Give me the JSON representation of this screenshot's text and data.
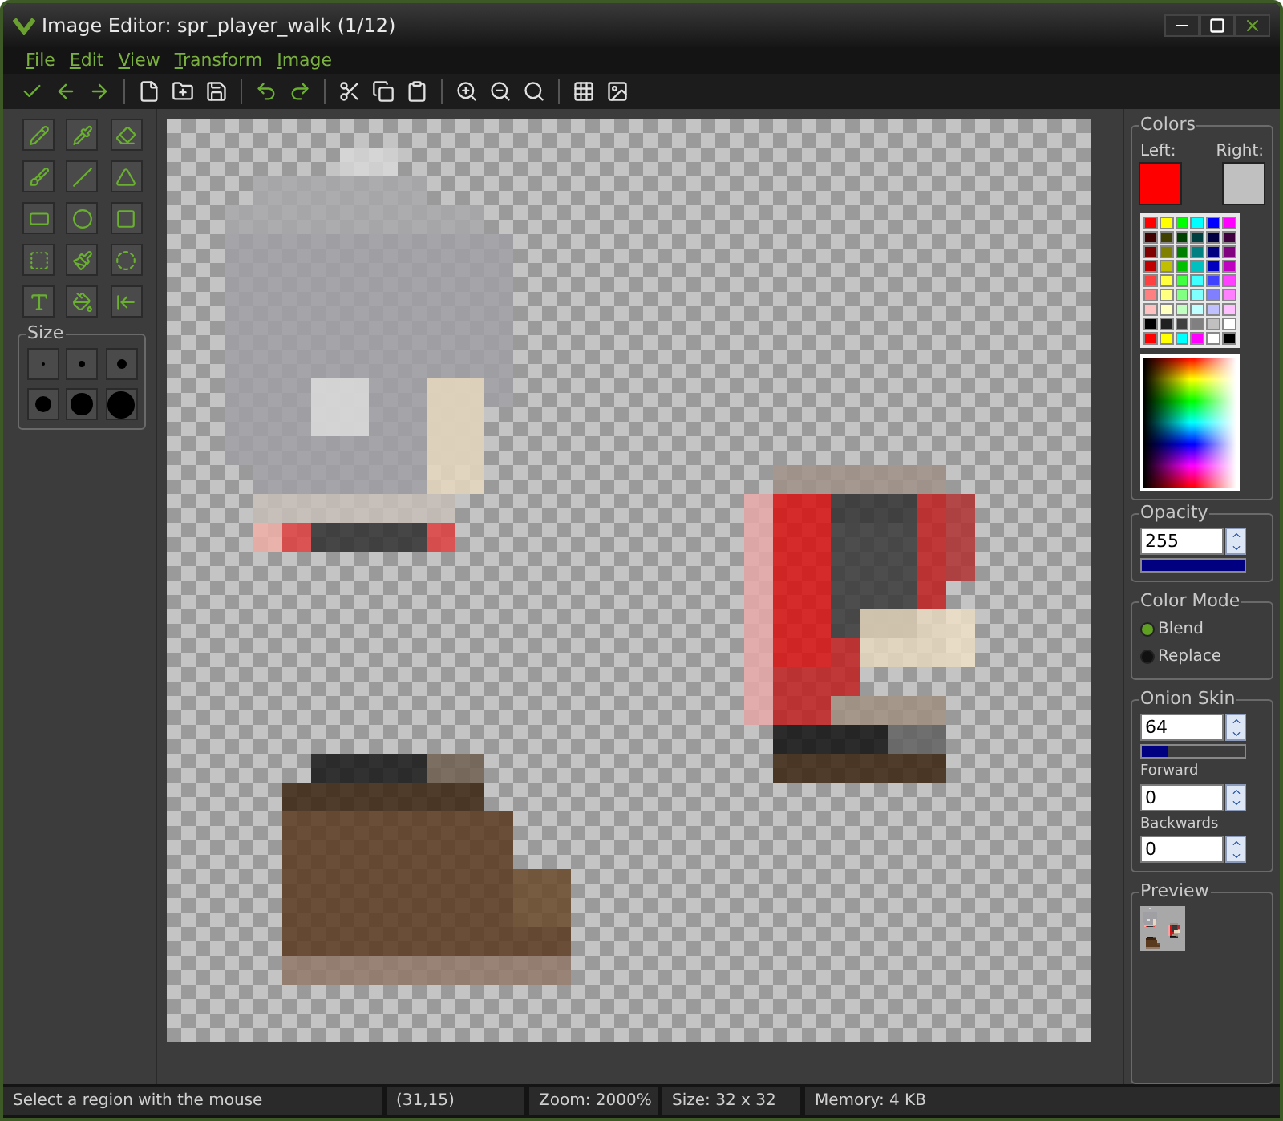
{
  "window": {
    "title": "Image Editor: spr_player_walk (1/12)"
  },
  "menu": [
    "File",
    "Edit",
    "View",
    "Transform",
    "Image"
  ],
  "colors": {
    "title": "Colors",
    "left_label": "Left:",
    "right_label": "Right:",
    "swatches": [
      {
        "color": "#ff0000"
      },
      {
        "color": "#c0c0c0"
      }
    ],
    "palette": [
      {
        "color": "#ff0000"
      },
      {
        "color": "#ffff00"
      },
      {
        "color": "#00ff00"
      },
      {
        "color": "#00ffff"
      },
      {
        "color": "#0000ff"
      },
      {
        "color": "#ff00ff"
      },
      {
        "color": "#400000"
      },
      {
        "color": "#404000"
      },
      {
        "color": "#004000"
      },
      {
        "color": "#004040"
      },
      {
        "color": "#000040"
      },
      {
        "color": "#400040"
      },
      {
        "color": "#800000"
      },
      {
        "color": "#808000"
      },
      {
        "color": "#008000"
      },
      {
        "color": "#008080"
      },
      {
        "color": "#000080"
      },
      {
        "color": "#800080"
      },
      {
        "color": "#c00000"
      },
      {
        "color": "#c0c000"
      },
      {
        "color": "#00c000"
      },
      {
        "color": "#00c0c0"
      },
      {
        "color": "#0000c0"
      },
      {
        "color": "#c000c0"
      },
      {
        "color": "#ff4040"
      },
      {
        "color": "#ffff40"
      },
      {
        "color": "#40ff40"
      },
      {
        "color": "#40ffff"
      },
      {
        "color": "#4040ff"
      },
      {
        "color": "#ff40ff"
      },
      {
        "color": "#ff8080"
      },
      {
        "color": "#ffff80"
      },
      {
        "color": "#80ff80"
      },
      {
        "color": "#80ffff"
      },
      {
        "color": "#8080ff"
      },
      {
        "color": "#ff80ff"
      },
      {
        "color": "#ffc0c0"
      },
      {
        "color": "#ffffc0"
      },
      {
        "color": "#c0ffc0"
      },
      {
        "color": "#c0ffff"
      },
      {
        "color": "#c0c0ff"
      },
      {
        "color": "#ffc0ff"
      },
      {
        "color": "#000000"
      },
      {
        "color": "#202020"
      },
      {
        "color": "#404040"
      },
      {
        "color": "#808080"
      },
      {
        "color": "#c0c0c0"
      },
      {
        "color": "#ffffff"
      },
      {
        "color": "#ff0000"
      },
      {
        "color": "#ffff00"
      },
      {
        "color": "#00ffff"
      },
      {
        "color": "#ff00ff"
      },
      {
        "color": "#ffffff"
      },
      {
        "color": "#000000"
      }
    ]
  },
  "size": {
    "title": "Size"
  },
  "opacity": {
    "title": "Opacity",
    "value": "255",
    "level": 1
  },
  "color_mode": {
    "title": "Color Mode",
    "options": [
      {
        "label": "Blend",
        "selected": true
      },
      {
        "label": "Replace",
        "selected": false
      }
    ]
  },
  "onion_skin": {
    "title": "Onion Skin",
    "value": "64",
    "level": 0.25,
    "forward_label": "Forward",
    "forward_value": "0",
    "backwards_label": "Backwards",
    "backwards_value": "0"
  },
  "preview": {
    "title": "Preview"
  },
  "status_bar": [
    "Select a region with the mouse",
    "(31,15)",
    "Zoom: 2000%",
    "Size: 32 x 32",
    "Memory: 4 KB"
  ]
}
